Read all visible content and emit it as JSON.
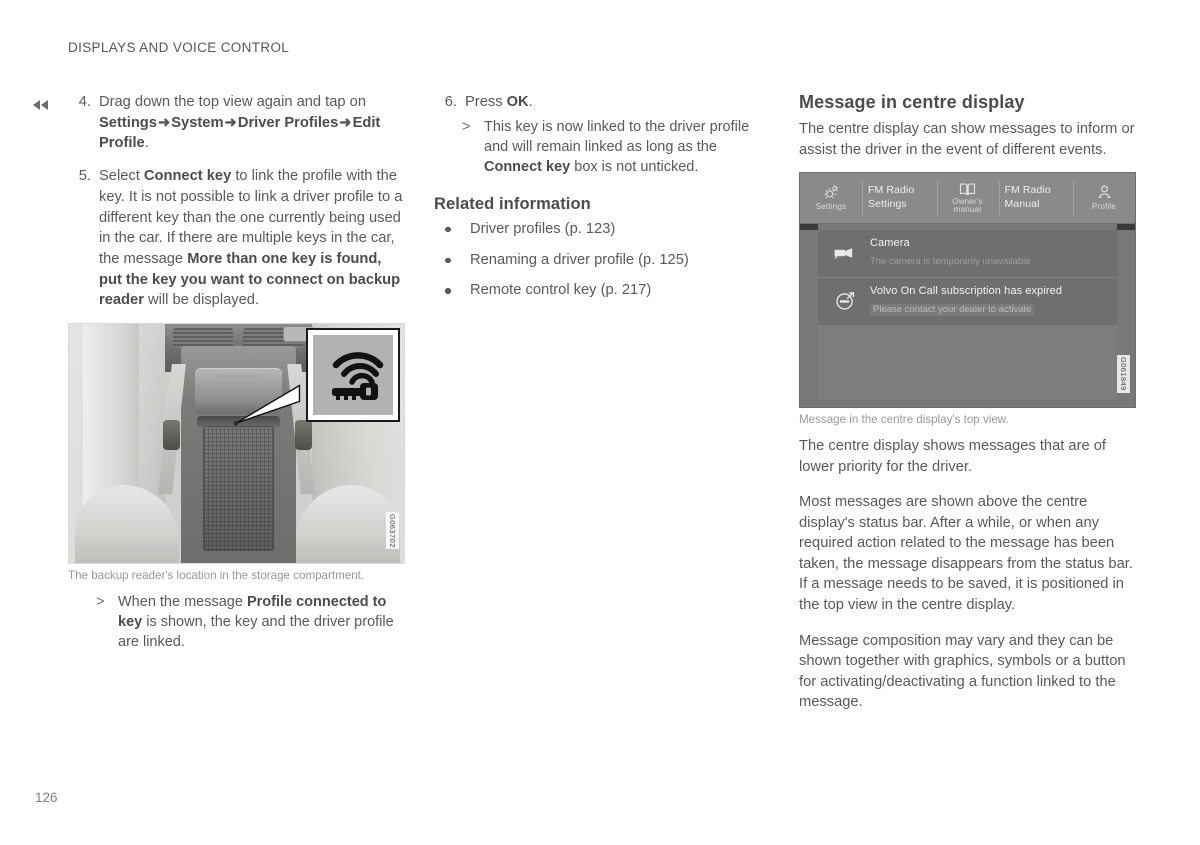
{
  "page": {
    "running_header": "DISPLAYS AND VOICE CONTROL",
    "page_number": "126",
    "continuation_marker": "back-arrows"
  },
  "column_left": {
    "steps": [
      {
        "number": "4.",
        "segments": [
          {
            "text": "Drag down the top view again and tap on ",
            "bold": false
          },
          {
            "text": "Settings",
            "bold": true
          },
          {
            "text": "ARROW",
            "bold": true,
            "arrow": true
          },
          {
            "text": "System",
            "bold": true
          },
          {
            "text": "ARROW",
            "bold": true,
            "arrow": true
          },
          {
            "text": "Driver Profiles",
            "bold": true
          },
          {
            "text": "ARROW",
            "bold": true,
            "arrow": true
          },
          {
            "text": "Edit Profile",
            "bold": true
          },
          {
            "text": ".",
            "bold": false
          }
        ]
      },
      {
        "number": "5.",
        "segments": [
          {
            "text": "Select ",
            "bold": false
          },
          {
            "text": "Connect key",
            "bold": true
          },
          {
            "text": " to link the profile with the key. It is not possible to link a driver profile to a different key than the one currently being used in the car. If there are multiple keys in the car, the message ",
            "bold": false
          },
          {
            "text": "More than one key is found, put the key you want to connect on backup reader",
            "bold": true
          },
          {
            "text": " will be displayed.",
            "bold": false
          }
        ]
      }
    ],
    "figure": {
      "caption": "The backup reader's location in the storage compartment.",
      "figure_id": "G063702",
      "inset_icon": "key-with-signal-waves-icon"
    },
    "sub_result": {
      "marker": ">",
      "segments": [
        {
          "text": "When the message ",
          "bold": false
        },
        {
          "text": "Profile connected to key",
          "bold": true
        },
        {
          "text": " is shown, the key and the driver profile are linked.",
          "bold": false
        }
      ]
    }
  },
  "column_middle": {
    "step": {
      "number": "6.",
      "segments": [
        {
          "text": "Press ",
          "bold": false
        },
        {
          "text": "OK",
          "bold": true
        },
        {
          "text": ".",
          "bold": false
        }
      ]
    },
    "sub_result": {
      "marker": ">",
      "segments": [
        {
          "text": "This key is now linked to the driver profile and will remain linked as long as the ",
          "bold": false
        },
        {
          "text": "Connect key",
          "bold": true
        },
        {
          "text": " box is not unticked.",
          "bold": false
        }
      ]
    },
    "related_information": {
      "heading": "Related information",
      "links": [
        "Driver profiles (p. 123)",
        "Renaming a driver profile (p. 125)",
        "Remote control key (p. 217)"
      ]
    }
  },
  "column_right": {
    "heading": "Message in centre display",
    "intro": "The centre display can show messages to inform or assist the driver in the event of different events.",
    "figure": {
      "caption": "Message in the centre display's top view.",
      "figure_id": "G061849",
      "topbar": [
        {
          "type": "icon",
          "name": "settings-gear-icon",
          "label": "Settings"
        },
        {
          "type": "text",
          "lines": [
            "FM Radio",
            "Settings"
          ]
        },
        {
          "type": "icon",
          "name": "owners-manual-book-icon",
          "label": "Owner's manual"
        },
        {
          "type": "text",
          "lines": [
            "FM Radio",
            "Manual"
          ]
        },
        {
          "type": "icon",
          "name": "profile-person-icon",
          "label": "Profile"
        }
      ],
      "messages": [
        {
          "icon": "camera-icon",
          "title": "Camera",
          "subtitle": "The camera is temporarily unavailable",
          "subtitle_boxed": false
        },
        {
          "icon": "volvo-logo-icon",
          "title": "Volvo On Call subscription has expired",
          "subtitle": "Please contact your dealer to activate",
          "subtitle_boxed": true
        }
      ]
    },
    "paragraphs": [
      "The centre display shows messages that are of lower priority for the driver.",
      "Most messages are shown above the centre display's status bar. After a while, or when any required action related to the message has been taken, the message disappears from the status bar. If a message needs to be saved, it is positioned in the top view in the centre display.",
      "Message composition may vary and they can be shown together with graphics, symbols or a button for activating/deactivating a function linked to the message."
    ]
  },
  "colors": {
    "text": "#58595b",
    "heading": "#4b4c4e",
    "caption": "#96989a",
    "display_bg": "#787878",
    "display_topbar": "#8a8a8a"
  }
}
